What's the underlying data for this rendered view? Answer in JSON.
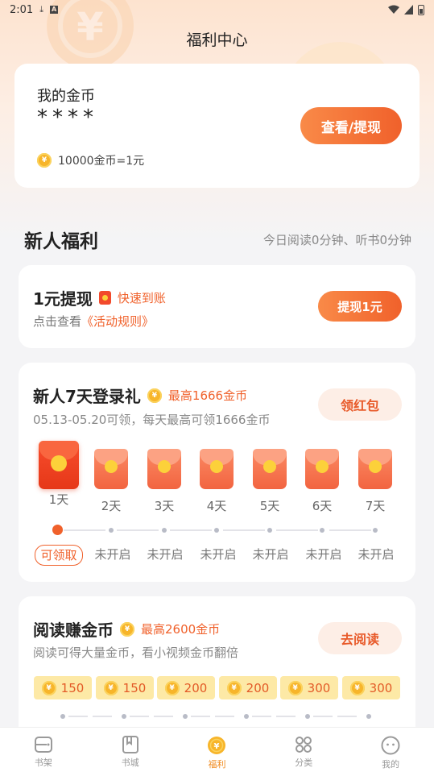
{
  "status_bar": {
    "time": "2:01",
    "download_icon": "download-icon",
    "a_badge": "A"
  },
  "header": {
    "title": "福利中心"
  },
  "wallet": {
    "label": "我的金币",
    "balance_masked": "****",
    "exchange_rate": "10000金币=1元",
    "action_label": "查看/提现"
  },
  "newbie": {
    "title": "新人福利",
    "today_stats": "今日阅读0分钟、听书0分钟"
  },
  "withdraw_card": {
    "title": "1元提现",
    "badge": "快速到账",
    "desc_prefix": "点击查看",
    "rules_link": "《活动规则》",
    "button": "提现1元"
  },
  "login_gift": {
    "title": "新人7天登录礼",
    "max_badge": "最高1666金币",
    "desc": "05.13-05.20可领，每天最高可领1666金币",
    "button": "领红包",
    "days": [
      "1天",
      "2天",
      "3天",
      "4天",
      "5天",
      "6天",
      "7天"
    ],
    "states": [
      "可领取",
      "未开启",
      "未开启",
      "未开启",
      "未开启",
      "未开启",
      "未开启"
    ],
    "current_day_index": 0
  },
  "read_earn": {
    "title": "阅读赚金币",
    "max_badge": "最高2600金币",
    "desc": "阅读可得大量金币，看小视频金币翻倍",
    "button": "去阅读",
    "rewards": [
      "150",
      "150",
      "200",
      "200",
      "300",
      "300"
    ]
  },
  "tabbar": {
    "items": [
      {
        "label": "书架",
        "icon": "bookshelf-icon"
      },
      {
        "label": "书城",
        "icon": "bookstore-icon"
      },
      {
        "label": "福利",
        "icon": "welfare-coin-icon",
        "active": true
      },
      {
        "label": "分类",
        "icon": "category-grid-icon"
      },
      {
        "label": "我的",
        "icon": "profile-face-icon"
      }
    ]
  },
  "colors": {
    "accent": "#f0612b",
    "coin": "#f7b52a",
    "tab_active": "#f08a1d"
  }
}
